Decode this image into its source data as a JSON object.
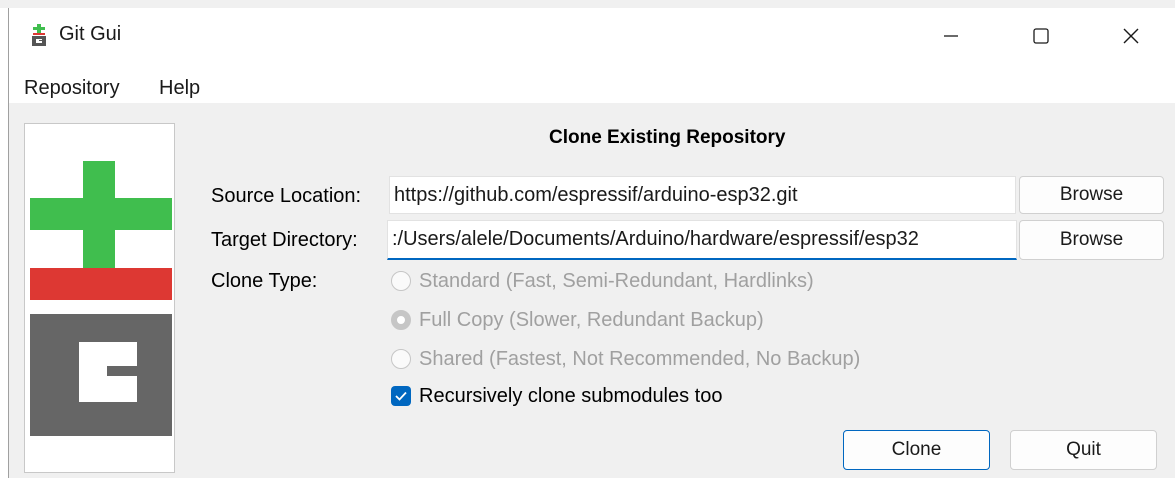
{
  "window": {
    "title": "Git Gui",
    "app_icon": "git-gui-icon",
    "controls": {
      "minimize_icon": "minimize-icon",
      "maximize_icon": "maximize-icon",
      "close_icon": "close-icon"
    }
  },
  "menu": {
    "items": [
      {
        "label": "Repository"
      },
      {
        "label": "Help"
      }
    ]
  },
  "dialog": {
    "heading": "Clone Existing Repository",
    "logo_icon": "git-logo-icon",
    "source": {
      "label": "Source Location:",
      "value": "https://github.com/espressif/arduino-esp32.git",
      "browse_label": "Browse"
    },
    "target": {
      "label": "Target Directory:",
      "value": ":/Users/alele/Documents/Arduino/hardware/espressif/esp32",
      "browse_label": "Browse"
    },
    "clone_type": {
      "label": "Clone Type:",
      "options": [
        {
          "label": "Standard (Fast, Semi-Redundant, Hardlinks)",
          "selected": false,
          "enabled": false
        },
        {
          "label": "Full Copy (Slower, Redundant Backup)",
          "selected": true,
          "enabled": false
        },
        {
          "label": "Shared (Fastest, Not Recommended, No Backup)",
          "selected": false,
          "enabled": false
        }
      ]
    },
    "recursive": {
      "label": "Recursively clone submodules too",
      "checked": true
    },
    "buttons": {
      "clone": "Clone",
      "quit": "Quit"
    }
  },
  "colors": {
    "accent": "#0067c0",
    "logo_green": "#40be4e",
    "logo_red": "#dd3833",
    "logo_gray": "#666666",
    "disabled_text": "#a0a0a0",
    "background": "#f0f0f0"
  }
}
